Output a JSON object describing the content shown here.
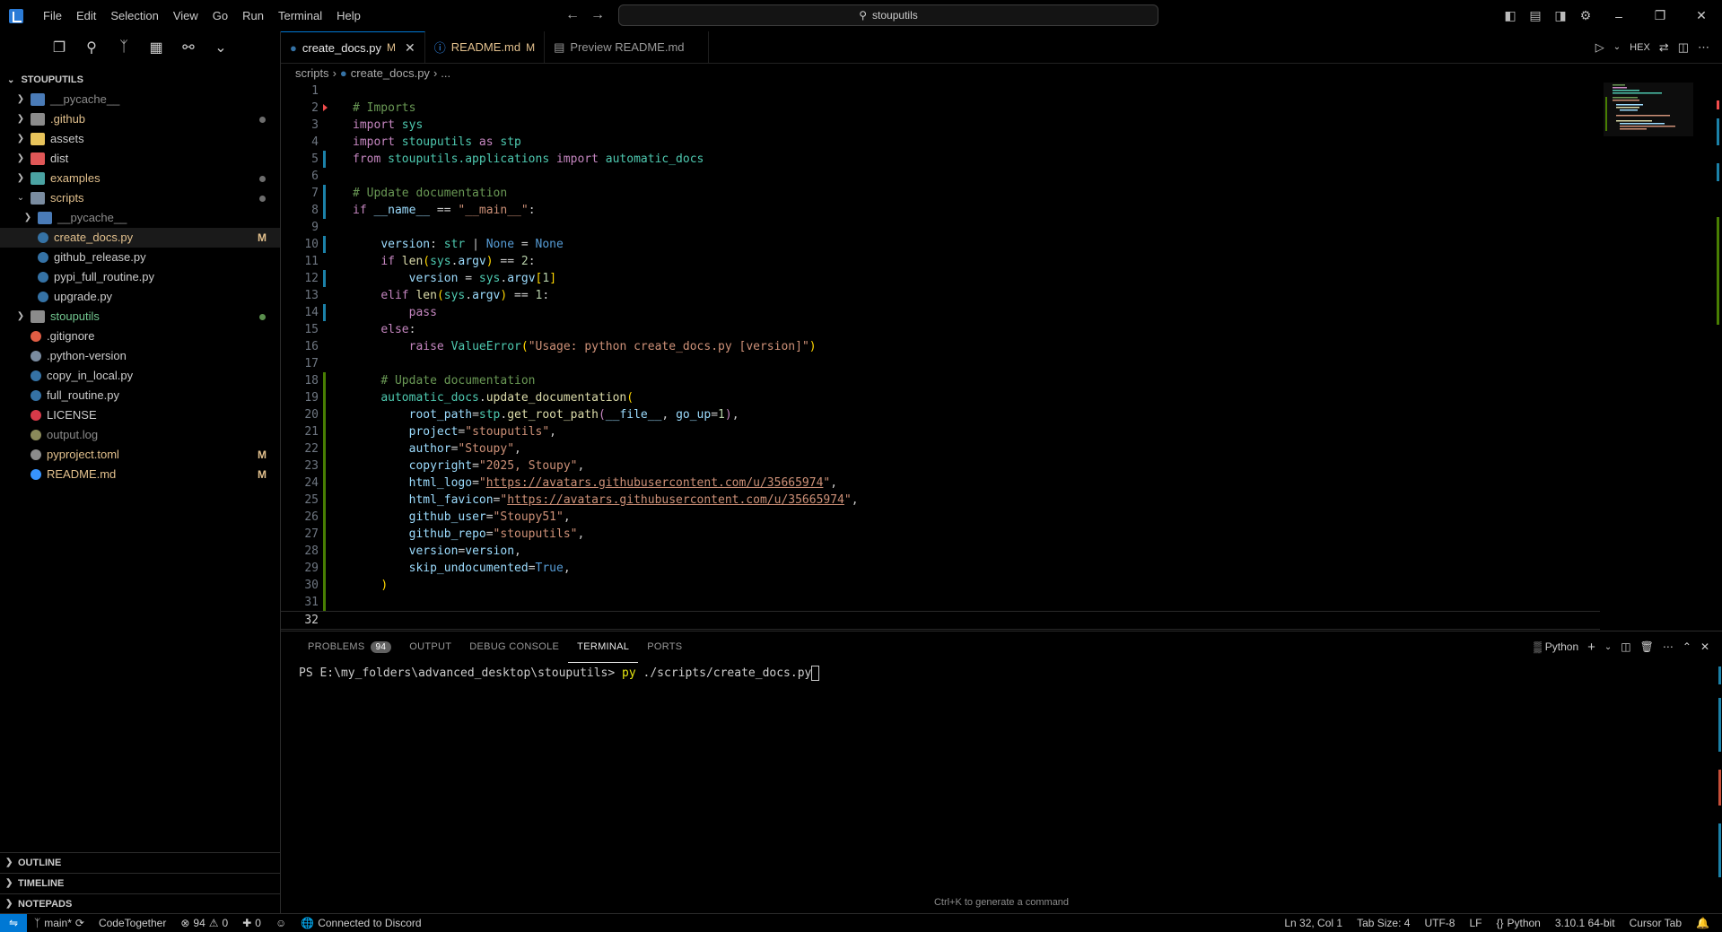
{
  "titlebar": {
    "menu": [
      "File",
      "Edit",
      "Selection",
      "View",
      "Go",
      "Run",
      "Terminal",
      "Help"
    ],
    "search_text": "stouputils"
  },
  "sidebar": {
    "explorer_title": "STOUPUTILS",
    "tree": [
      {
        "label": "__pycache__",
        "depth": 0,
        "type": "folder",
        "expanded": false,
        "color": "#4a7bb7",
        "label_color": "#8b8b8b"
      },
      {
        "label": ".github",
        "depth": 0,
        "type": "folder",
        "expanded": false,
        "color": "#8b8b8b",
        "label_color": "#e2c08d",
        "dot": true
      },
      {
        "label": "assets",
        "depth": 0,
        "type": "folder",
        "expanded": false,
        "color": "#e8c45b",
        "label_color": "#cccccc"
      },
      {
        "label": "dist",
        "depth": 0,
        "type": "folder",
        "expanded": false,
        "color": "#e05757",
        "label_color": "#cccccc"
      },
      {
        "label": "examples",
        "depth": 0,
        "type": "folder",
        "expanded": false,
        "color": "#4aa3a3",
        "label_color": "#e2c08d",
        "dot": true
      },
      {
        "label": "scripts",
        "depth": 0,
        "type": "folder",
        "expanded": true,
        "color": "#7a8ca0",
        "label_color": "#e2c08d",
        "dot": true
      },
      {
        "label": "__pycache__",
        "depth": 1,
        "type": "folder",
        "expanded": false,
        "color": "#4a7bb7",
        "label_color": "#8b8b8b"
      },
      {
        "label": "create_docs.py",
        "depth": 1,
        "type": "file",
        "color": "#3572a5",
        "label_color": "#e2c08d",
        "badge": "M",
        "selected": true
      },
      {
        "label": "github_release.py",
        "depth": 1,
        "type": "file",
        "color": "#3572a5",
        "label_color": "#cccccc"
      },
      {
        "label": "pypi_full_routine.py",
        "depth": 1,
        "type": "file",
        "color": "#3572a5",
        "label_color": "#cccccc"
      },
      {
        "label": "upgrade.py",
        "depth": 1,
        "type": "file",
        "color": "#3572a5",
        "label_color": "#cccccc"
      },
      {
        "label": "stouputils",
        "depth": 0,
        "type": "folder",
        "expanded": false,
        "color": "#8b8b8b",
        "label_color": "#73c991",
        "dot": true,
        "dot_green": true
      },
      {
        "label": ".gitignore",
        "depth": 0,
        "type": "file",
        "color": "#e05d44",
        "label_color": "#cccccc"
      },
      {
        "label": ".python-version",
        "depth": 0,
        "type": "file",
        "color": "#7a8ca0",
        "label_color": "#cccccc"
      },
      {
        "label": "copy_in_local.py",
        "depth": 0,
        "type": "file",
        "color": "#3572a5",
        "label_color": "#cccccc"
      },
      {
        "label": "full_routine.py",
        "depth": 0,
        "type": "file",
        "color": "#3572a5",
        "label_color": "#cccccc"
      },
      {
        "label": "LICENSE",
        "depth": 0,
        "type": "file",
        "color": "#d73a49",
        "label_color": "#cccccc"
      },
      {
        "label": "output.log",
        "depth": 0,
        "type": "file",
        "color": "#8a8a5a",
        "label_color": "#8b8b8b"
      },
      {
        "label": "pyproject.toml",
        "depth": 0,
        "type": "file",
        "color": "#8b8b8b",
        "label_color": "#e2c08d",
        "badge": "M"
      },
      {
        "label": "README.md",
        "depth": 0,
        "type": "file",
        "color": "#3794ff",
        "label_color": "#e2c08d",
        "badge": "M"
      }
    ],
    "bottom_sections": [
      "OUTLINE",
      "TIMELINE",
      "NOTEPADS"
    ]
  },
  "tabs": [
    {
      "label": "create_docs.py",
      "modified": "M",
      "active": true,
      "icon": "python-icon"
    },
    {
      "label": "README.md",
      "modified": "M",
      "active": false,
      "icon": "info-icon"
    },
    {
      "label": "Preview README.md",
      "modified": "",
      "active": false,
      "icon": "preview-icon"
    }
  ],
  "editor_actions": {
    "hex": "HEX"
  },
  "breadcrumb": {
    "folder": "scripts",
    "file": "create_docs.py",
    "more": "..."
  },
  "code_lines": [
    {
      "n": "1",
      "mark": "",
      "html": ""
    },
    {
      "n": "2",
      "mark": "red-tri",
      "html": "<span class='cm'># Imports</span>"
    },
    {
      "n": "3",
      "mark": "",
      "html": "<span class='kw'>import</span> <span class='cls'>sys</span>"
    },
    {
      "n": "4",
      "mark": "",
      "html": "<span class='kw'>import</span> <span class='cls'>stouputils</span> <span class='kw'>as</span> <span class='cls'>stp</span>"
    },
    {
      "n": "5",
      "mark": "blue",
      "html": "<span class='kw'>from</span> <span class='cls'>stouputils.applications</span> <span class='kw'>import</span> <span class='cls'>automatic_docs</span>"
    },
    {
      "n": "6",
      "mark": "",
      "html": ""
    },
    {
      "n": "7",
      "mark": "blue",
      "html": "<span class='cm'># Update documentation</span>"
    },
    {
      "n": "8",
      "mark": "blue",
      "html": "<span class='kw'>if</span> <span class='var'>__name__</span> == <span class='str'>\"__main__\"</span>:"
    },
    {
      "n": "9",
      "mark": "",
      "html": ""
    },
    {
      "n": "10",
      "mark": "blue",
      "html": "    <span class='var'>version</span>: <span class='cls'>str</span> | <span class='kw2'>None</span> = <span class='kw2'>None</span>"
    },
    {
      "n": "11",
      "mark": "",
      "html": "    <span class='kw'>if</span> <span class='fn'>len</span><span class='par'>(</span><span class='cls'>sys</span>.<span class='var'>argv</span><span class='par'>)</span> == <span class='num'>2</span>:"
    },
    {
      "n": "12",
      "mark": "blue",
      "html": "        <span class='var'>version</span> = <span class='cls'>sys</span>.<span class='var'>argv</span><span class='par'>[</span><span class='num'>1</span><span class='par'>]</span>"
    },
    {
      "n": "13",
      "mark": "",
      "html": "    <span class='kw'>elif</span> <span class='fn'>len</span><span class='par'>(</span><span class='cls'>sys</span>.<span class='var'>argv</span><span class='par'>)</span> == <span class='num'>1</span>:"
    },
    {
      "n": "14",
      "mark": "blue",
      "html": "        <span class='kw'>pass</span>"
    },
    {
      "n": "15",
      "mark": "",
      "html": "    <span class='kw'>else</span>:"
    },
    {
      "n": "16",
      "mark": "",
      "html": "        <span class='kw'>raise</span> <span class='cls'>ValueError</span><span class='par'>(</span><span class='str'>\"Usage: python create_docs.py [version]\"</span><span class='par'>)</span>"
    },
    {
      "n": "17",
      "mark": "",
      "html": ""
    },
    {
      "n": "18",
      "mark": "green",
      "html": "    <span class='cm'># Update documentation</span>"
    },
    {
      "n": "19",
      "mark": "green",
      "html": "    <span class='cls'>automatic_docs</span>.<span class='fn'>update_documentation</span><span class='par'>(</span>"
    },
    {
      "n": "20",
      "mark": "green",
      "html": "        <span class='var'>root_path</span>=<span class='cls'>stp</span>.<span class='fn'>get_root_path</span><span class='kw'>(</span><span class='var'>__file__</span>, <span class='var'>go_up</span>=<span class='num'>1</span><span class='kw'>)</span>,"
    },
    {
      "n": "21",
      "mark": "green",
      "html": "        <span class='var'>project</span>=<span class='str'>\"stouputils\"</span>,"
    },
    {
      "n": "22",
      "mark": "green",
      "html": "        <span class='var'>author</span>=<span class='str'>\"Stoupy\"</span>,"
    },
    {
      "n": "23",
      "mark": "green",
      "html": "        <span class='var'>copyright</span>=<span class='str'>\"2025, Stoupy\"</span>,"
    },
    {
      "n": "24",
      "mark": "green",
      "html": "        <span class='var'>html_logo</span>=<span class='str'>\"<span class='url'>https://avatars.githubusercontent.com/u/35665974</span>\"</span>,"
    },
    {
      "n": "25",
      "mark": "green",
      "html": "        <span class='var'>html_favicon</span>=<span class='str'>\"<span class='url'>https://avatars.githubusercontent.com/u/35665974</span>\"</span>,"
    },
    {
      "n": "26",
      "mark": "green",
      "html": "        <span class='var'>github_user</span>=<span class='str'>\"Stoupy51\"</span>,"
    },
    {
      "n": "27",
      "mark": "green",
      "html": "        <span class='var'>github_repo</span>=<span class='str'>\"stouputils\"</span>,"
    },
    {
      "n": "28",
      "mark": "green",
      "html": "        <span class='var'>version</span>=<span class='var'>version</span>,"
    },
    {
      "n": "29",
      "mark": "green",
      "html": "        <span class='var'>skip_undocumented</span>=<span class='kw2'>True</span>,"
    },
    {
      "n": "30",
      "mark": "green",
      "html": "    <span class='par'>)</span>"
    },
    {
      "n": "31",
      "mark": "green",
      "html": ""
    },
    {
      "n": "32",
      "mark": "",
      "html": "",
      "current": true
    }
  ],
  "panel": {
    "tabs": [
      {
        "label": "PROBLEMS",
        "badge": "94"
      },
      {
        "label": "OUTPUT"
      },
      {
        "label": "DEBUG CONSOLE"
      },
      {
        "label": "TERMINAL",
        "active": true
      },
      {
        "label": "PORTS"
      }
    ],
    "terminal_profile": "Python",
    "prompt": "PS E:\\my_folders\\advanced_desktop\\stouputils> ",
    "command_py": "py",
    "command_args": " ./scripts/create_docs.py",
    "hint": "Ctrl+K to generate a command"
  },
  "statusbar": {
    "branch": "main*",
    "codetogether": "CodeTogether",
    "errors": "94",
    "warnings": "0",
    "ports": "0",
    "discord": "Connected to Discord",
    "position": "Ln 32, Col 1",
    "tab_size": "Tab Size: 4",
    "encoding": "UTF-8",
    "eol": "LF",
    "language": "Python",
    "interpreter": "3.10.1 64-bit",
    "cursor": "Cursor Tab"
  },
  "colors": {
    "accent": "#0078d4",
    "modified": "#e2c08d",
    "added": "#73c991"
  }
}
